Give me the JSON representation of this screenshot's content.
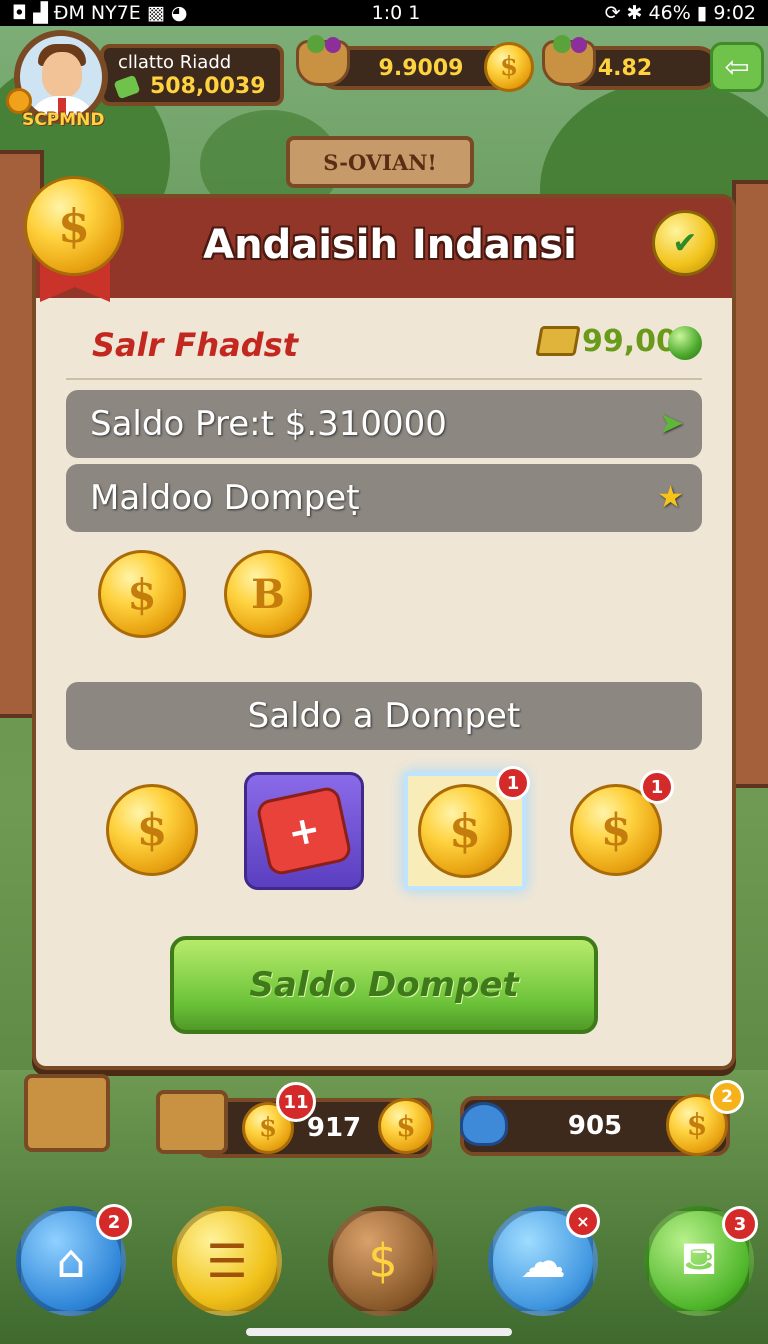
{
  "status_bar": {
    "left": "◘ ▟ ÐM NY7E ▩ ◕",
    "center": "1:0 1",
    "right_icons": "⟳ ✱",
    "battery": "46%",
    "time": "9:02"
  },
  "profile": {
    "name": "cllatto Riadd",
    "balance": "508,0039",
    "rank": "SCPMND"
  },
  "resources": {
    "bar1_value": "9.9009",
    "bar2_value": "4.82"
  },
  "sign": {
    "label": "S-OVIAN!"
  },
  "dialog": {
    "title": "Andaisih Indansi",
    "section_title": "Salr Fhadst",
    "cash_value": "99,00",
    "row1": "Saldo Pre:t $.310000",
    "row2": "Maldoo Dompeṭ",
    "row3": "Saldo a Dompet",
    "coin_row1": [
      "$",
      "B"
    ],
    "coin_row2": [
      "$",
      "+",
      "$",
      "$"
    ],
    "badge_selected": "1",
    "badge_last": "1",
    "cta_label": "Saldo Dompet"
  },
  "lower_strip": {
    "badge": "11",
    "value_left": "917",
    "value_right": "905",
    "badge_right": "2"
  },
  "nav": {
    "home_badge": "2",
    "ghost_badge": "×",
    "shop_badge": "3"
  },
  "colors": {
    "dialog_header": "#93362a",
    "dialog_body": "#efe6d6",
    "cta_green": "#6cc33a",
    "badge_red": "#d42a2a",
    "coin_gold": "#ffd23f"
  }
}
